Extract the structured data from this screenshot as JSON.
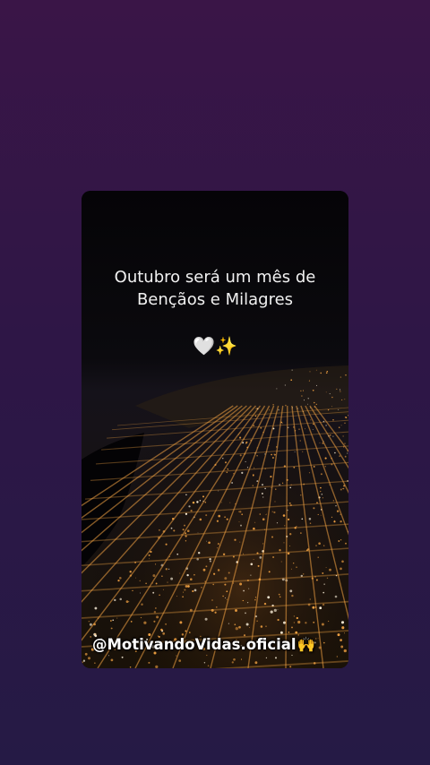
{
  "caption": {
    "line1": "Outubro será um mês de",
    "line2": "Bençãos e Milagres"
  },
  "emojis": {
    "heart": "🤍",
    "sparkles": "✨"
  },
  "watermark": {
    "handle": "@MotivandoVidas.oficial",
    "emoji": "🙌"
  },
  "colors": {
    "background_top": "#3a1547",
    "background_bottom": "#251a45",
    "city_light": "#f2a243"
  }
}
